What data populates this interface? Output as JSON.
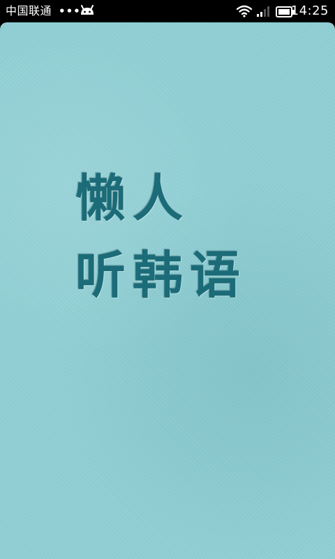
{
  "status_bar": {
    "carrier": "中国联通",
    "dots": "•••",
    "time": "14:25"
  },
  "splash": {
    "title_line_1": "懒人",
    "title_line_2": "听韩语"
  },
  "colors": {
    "background": "#8fcfd4",
    "title": "#1b6b78",
    "status_bar": "#000000"
  },
  "icons": [
    "android-icon",
    "wifi-icon",
    "signal-icon",
    "battery-icon"
  ]
}
